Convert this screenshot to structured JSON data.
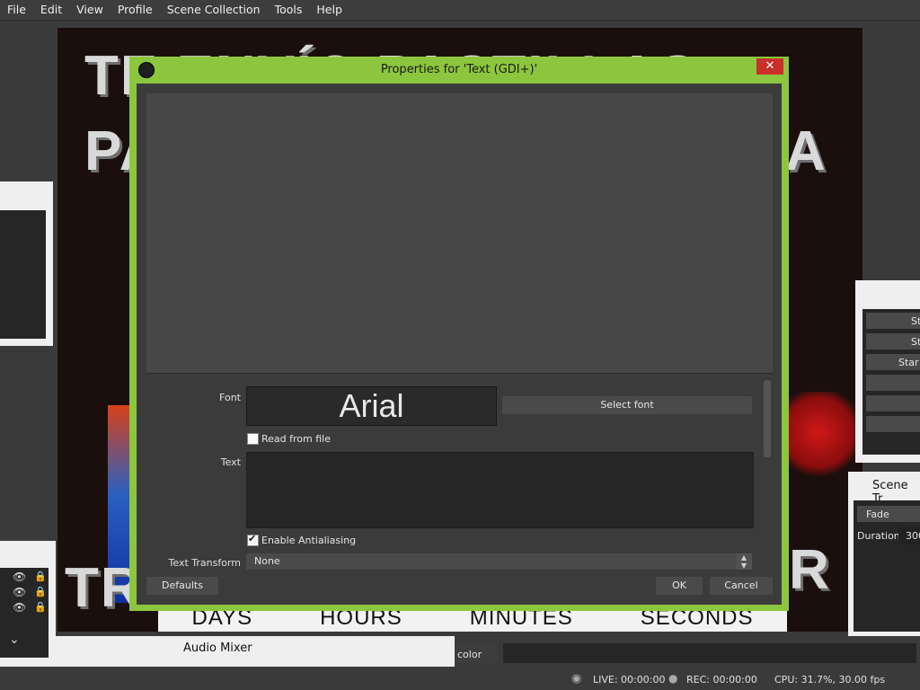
{
  "menu": [
    "File",
    "Edit",
    "View",
    "Profile",
    "Scene Collection",
    "Tools",
    "Help"
  ],
  "preview": {
    "line1": "TE ENVÍO PASTILLAS",
    "line2": "PARA",
    "line3": "A",
    "bottom_left": "TR",
    "bottom_right": "R",
    "countdown": [
      "DAYS",
      "HOURS",
      "MINUTES",
      "SECONDS"
    ]
  },
  "dialog": {
    "title": "Properties for 'Text (GDI+)'",
    "close_symbol": "✕",
    "font_label": "Font",
    "font_preview": "Arial",
    "select_font": "Select font",
    "read_from_file": "Read from file",
    "text_label": "Text",
    "text_value": "",
    "enable_antialiasing": "Enable Antialiasing",
    "antialiasing_checked": true,
    "read_from_file_checked": false,
    "text_transform_label": "Text Transform",
    "text_transform_value": "None",
    "defaults": "Defaults",
    "ok": "OK",
    "cancel": "Cancel"
  },
  "right_dock": {
    "buttons": [
      "St",
      "St",
      "Star"
    ],
    "scene_transitions_title": "Scene Tr",
    "transition_value": "Fade",
    "duration_label": "Duration",
    "duration_value": "300"
  },
  "audio_mixer": {
    "title": "Audio Mixer"
  },
  "color_label": "color",
  "status": {
    "live": "LIVE: 00:00:00",
    "rec": "REC: 00:00:00",
    "cpu": "CPU: 31.7%, 30.00 fps"
  }
}
